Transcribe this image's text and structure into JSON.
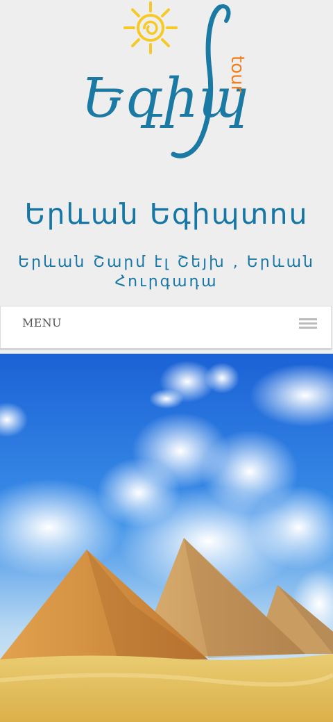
{
  "header": {
    "logo_text": "Եգիպ",
    "logo_tour": "tour",
    "site_title": "Երևան Եգիպտոս",
    "tagline": "Երևան Շարմ էլ Շեյխ , Երևան Հուրգադա"
  },
  "nav": {
    "menu_label": "MENU",
    "menu_icon": "hamburger-icon"
  },
  "hero": {
    "image": "pyramids-photo"
  },
  "colors": {
    "accent": "#1676a6",
    "logo_orange": "#f07f1f",
    "sun_yellow": "#f7c927",
    "background": "#eeeeee"
  }
}
